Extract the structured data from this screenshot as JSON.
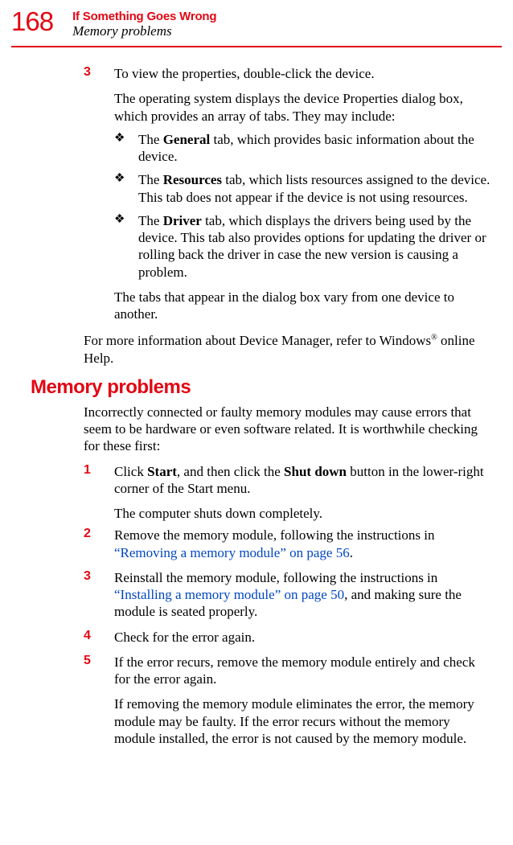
{
  "header": {
    "page_number": "168",
    "chapter": "If Something Goes Wrong",
    "section": "Memory problems"
  },
  "body": {
    "step3_num": "3",
    "step3_text_a": "To view the properties, double-click the device.",
    "step3_text_b1": "The operating system displays the device Properties dialog box, which provides an array of tabs. They may include:",
    "bullet1_a": "The ",
    "bullet1_b": "General",
    "bullet1_c": " tab, which provides basic information about the device.",
    "bullet2_a": "The ",
    "bullet2_b": "Resources",
    "bullet2_c": " tab, which lists resources assigned to the device. This tab does not appear if the device is not using resources.",
    "bullet3_a": "The ",
    "bullet3_b": "Driver",
    "bullet3_c": " tab, which displays the drivers being used by the device. This tab also provides options for updating the driver or rolling back the driver in case the new version is causing a problem.",
    "step3_text_c": "The tabs that appear in the dialog box vary from one device to another.",
    "outer1_a": "For more information about Device Manager, refer to Windows",
    "outer1_sup": "®",
    "outer1_b": " online Help.",
    "heading": "Memory problems",
    "intro": "Incorrectly connected or faulty memory modules may cause errors that seem to be hardware or even software related. It is worthwhile checking for these first:",
    "m1_num": "1",
    "m1_a": "Click ",
    "m1_b": "Start",
    "m1_c": ", and then click the ",
    "m1_d": "Shut down",
    "m1_e": " button in the lower-right corner of the Start menu.",
    "m1_f": "The computer shuts down completely.",
    "m2_num": "2",
    "m2_a": "Remove the memory module, following the instructions in ",
    "m2_link": "“Removing a memory module” on page 56",
    "m2_b": ".",
    "m3_num": "3",
    "m3_a": "Reinstall the memory module, following the instructions in ",
    "m3_link": "“Installing a memory module” on page 50",
    "m3_b": ", and making sure the module is seated properly.",
    "m4_num": "4",
    "m4_a": "Check for the error again.",
    "m5_num": "5",
    "m5_a": "If the error recurs, remove the memory module entirely and check for the error again.",
    "m5_b": "If removing the memory module eliminates the error, the memory module may be faulty. If the error recurs without the memory module installed, the error is not caused by the memory module."
  },
  "bullet_glyph": "❖"
}
